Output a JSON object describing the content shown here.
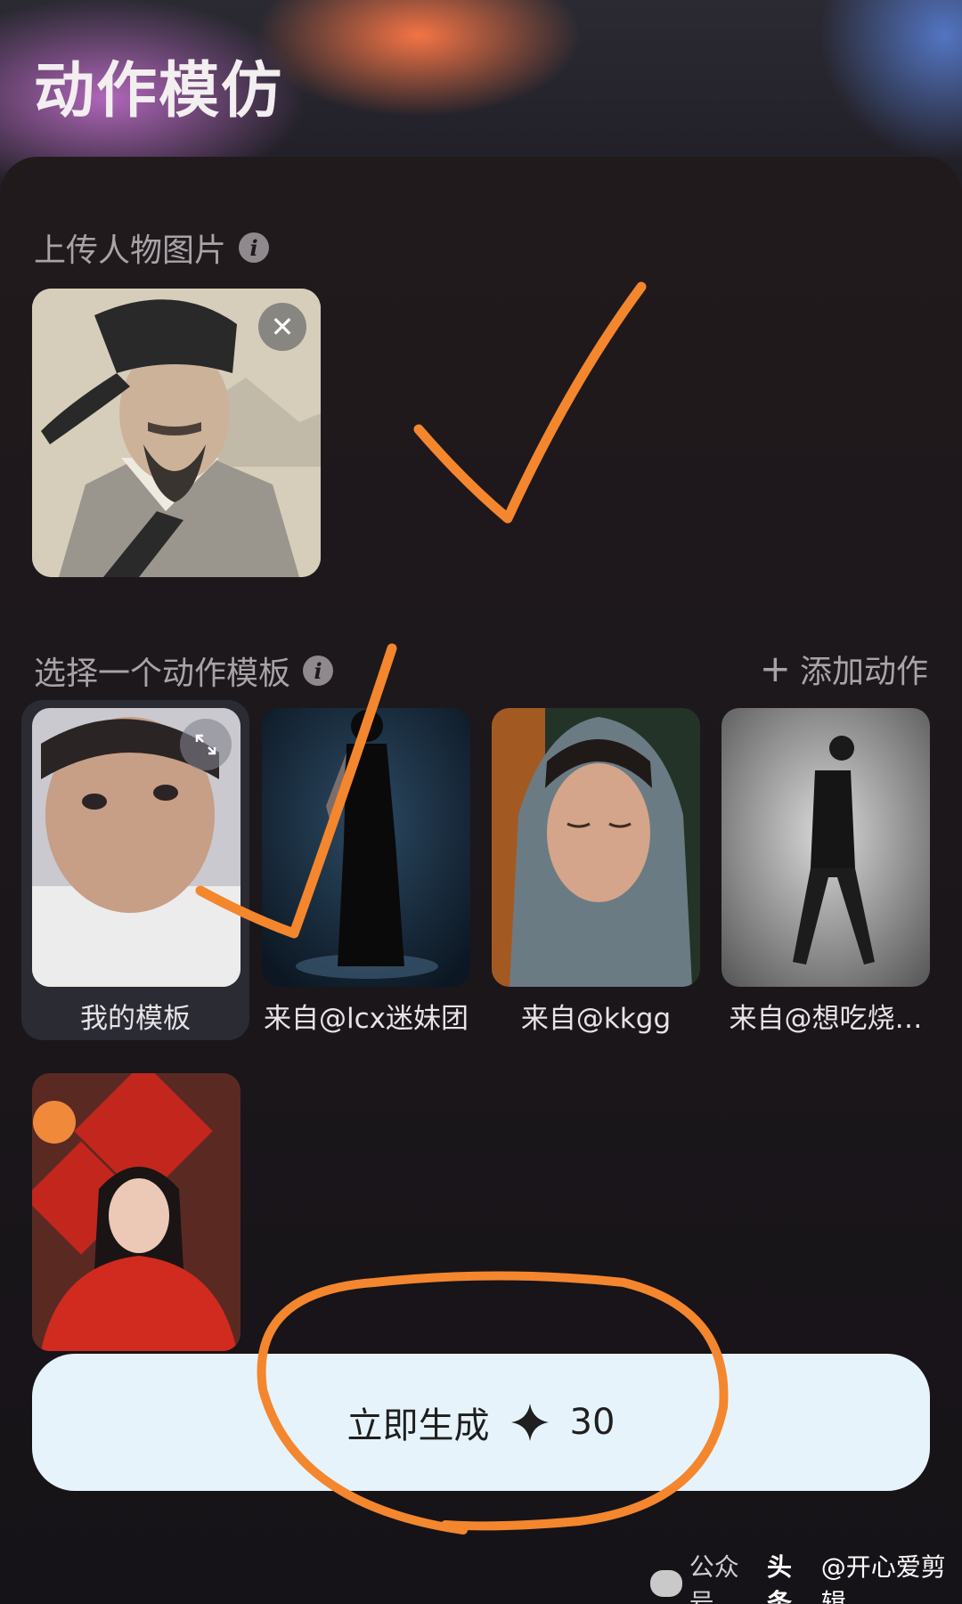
{
  "page": {
    "title": "动作模仿"
  },
  "upload_section": {
    "label": "上传人物图片",
    "info_icon": "info-icon",
    "close_icon": "close-icon"
  },
  "template_section": {
    "label": "选择一个动作模板",
    "add_action_label": "添加动作",
    "add_icon": "plus-icon",
    "expand_icon": "expand-icon",
    "templates": [
      {
        "caption": "我的模板",
        "selected": true
      },
      {
        "caption": "来自@lcx迷妹团",
        "selected": false
      },
      {
        "caption": "来自@kkgg",
        "selected": false
      },
      {
        "caption": "来自@想吃烧…",
        "selected": false
      }
    ]
  },
  "generate_button": {
    "label": "立即生成",
    "cost": "30",
    "cost_icon": "sparkle-icon"
  },
  "watermark": {
    "prefix": "公众号",
    "site": "头条",
    "author": "@开心爱剪辑"
  },
  "colors": {
    "annotation": "#f4862e",
    "button_bg": "#e7f3fb",
    "panel_bg": "#1d181b"
  }
}
